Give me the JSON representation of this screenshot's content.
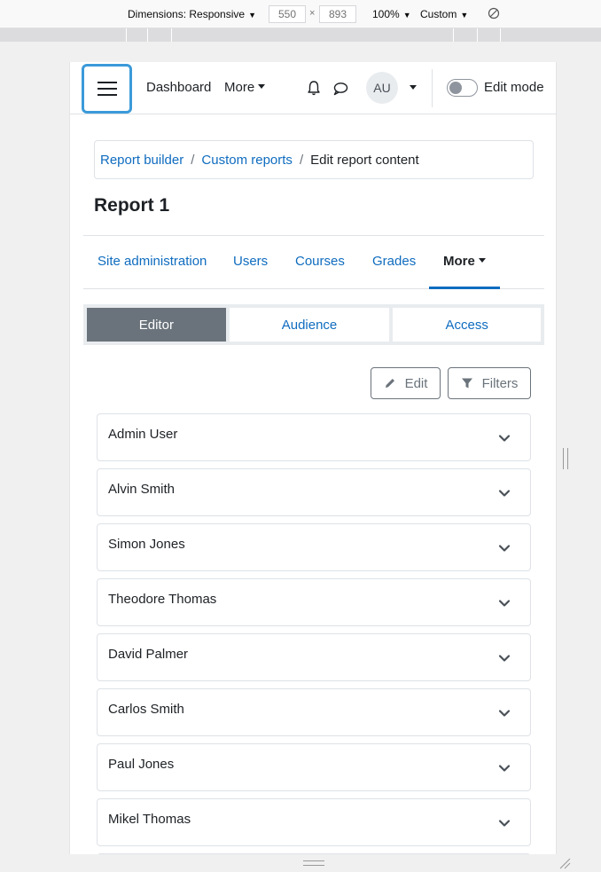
{
  "devtools": {
    "dimensions_label": "Dimensions: Responsive",
    "width": "550",
    "times": "×",
    "height": "893",
    "zoom": "100%",
    "throttle": "Custom"
  },
  "navbar": {
    "dashboard": "Dashboard",
    "more": "More",
    "avatar_initials": "AU",
    "edit_mode": "Edit mode"
  },
  "breadcrumb": {
    "items": [
      "Report builder",
      "Custom reports"
    ],
    "separator": "/",
    "current": "Edit report content"
  },
  "page_title": "Report 1",
  "secondary_nav": {
    "tabs": [
      "Site administration",
      "Users",
      "Courses",
      "Grades"
    ],
    "more": "More"
  },
  "editor_tabs": {
    "editor": "Editor",
    "audience": "Audience",
    "access": "Access"
  },
  "actions": {
    "edit": "Edit",
    "filters": "Filters"
  },
  "users": [
    "Admin User",
    "Alvin Smith",
    "Simon Jones",
    "Theodore Thomas",
    "David Palmer",
    "Carlos Smith",
    "Paul Jones",
    "Mikel Thomas"
  ],
  "colors": {
    "link": "#0f6cbf",
    "active_tab": "#6a737b",
    "focus": "#3b9ad9"
  }
}
